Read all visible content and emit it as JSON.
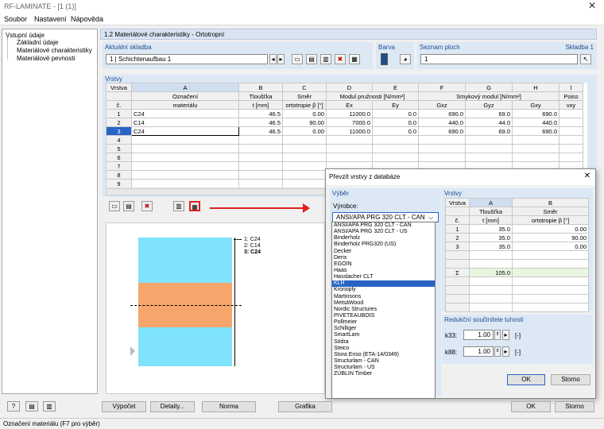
{
  "window": {
    "title": "RF-LAMINATE - [1 (1)]",
    "close": "✕"
  },
  "menu": [
    "Soubor",
    "Nastavení",
    "Nápověda"
  ],
  "tree": {
    "root": "Vstupní údaje",
    "items": [
      "Základní údaje",
      "Materiálové charakteristiky",
      "Materiálové pevnosti"
    ]
  },
  "header": "1.2 Materiálové charakteristiky - Ortotropní",
  "current": {
    "label": "Aktuální skladba",
    "value": "1 | Schichtenaufbau 1"
  },
  "color": {
    "label": "Barva",
    "swatch": "#1f4e8c"
  },
  "areas": {
    "label": "Seznam ploch",
    "value": "1",
    "right": "Skladba 1"
  },
  "layers": {
    "label": "Vrstvy",
    "letters": [
      "A",
      "B",
      "C",
      "D",
      "E",
      "F",
      "G",
      "H",
      "I"
    ],
    "h1": [
      "Vrstva",
      "Označení",
      "Tloušťka",
      "Směr",
      "Modul pružnosti [N/mm²]",
      "",
      "Smykový modul [N/mm²]",
      "",
      "",
      "Poiss"
    ],
    "h2": [
      "č.",
      "materiálu",
      "t [mm]",
      "ortotropie β [°]",
      "Ex",
      "Ey",
      "Gxz",
      "Gyz",
      "Gxy",
      "νxy"
    ],
    "rows": [
      [
        "1",
        "C24",
        "46.5",
        "0.00",
        "11000.0",
        "0.0",
        "690.0",
        "69.0",
        "690.0",
        ""
      ],
      [
        "2",
        "C14",
        "46.5",
        "90.00",
        "7000.0",
        "0.0",
        "440.0",
        "44.0",
        "440.0",
        ""
      ],
      [
        "3",
        "C24",
        "46.5",
        "0.00",
        "11000.0",
        "0.0",
        "690.0",
        "69.0",
        "690.0",
        ""
      ],
      [
        "4",
        "",
        "",
        "",
        "",
        "",
        "",
        "",
        "",
        ""
      ],
      [
        "5",
        "",
        "",
        "",
        "",
        "",
        "",
        "",
        "",
        ""
      ],
      [
        "6",
        "",
        "",
        "",
        "",
        "",
        "",
        "",
        "",
        ""
      ],
      [
        "7",
        "",
        "",
        "",
        "",
        "",
        "",
        "",
        "",
        ""
      ],
      [
        "8",
        "",
        "",
        "",
        "",
        "",
        "",
        "",
        "",
        ""
      ],
      [
        "9",
        "",
        "",
        "",
        "",
        "",
        "",
        "",
        "",
        ""
      ]
    ]
  },
  "legend": [
    "1: C24",
    "2: C14",
    "3: C24"
  ],
  "dialog": {
    "title": "Převzít vrstvy z databáze",
    "close": "✕",
    "select_label": "Výběr",
    "maker_label": "Výrobce:",
    "maker_value": "ANSI/APA PRG 320 CLT - CAN",
    "makers": [
      "ANSI/APA PRG 320 CLT - CAN",
      "ANSI/APA PRG 320 CLT - US",
      "Binderholz",
      "Binderholz PRG320 (US)",
      "Decker",
      "Derix",
      "EGOIN",
      "Haas",
      "Hasslacher CLT",
      "KLH",
      "Kronoply",
      "Martinsons",
      "MetsäWood",
      "Nordic Structures",
      "PIVETEAUBOIS",
      "Pollmeier",
      "Schilliger",
      "SmartLam",
      "Södra",
      "Steico",
      "Stora Enso (ETA-14/0349)",
      "Structurlam - CAN",
      "Structurlam - US",
      "ZÜBLIN Timber"
    ],
    "highlight": "KLH",
    "layers_label": "Vrstvy",
    "letters": [
      "A",
      "B"
    ],
    "h1": [
      "Vrstva",
      "Tloušťka",
      "Směr"
    ],
    "h2": [
      "č.",
      "t [mm]",
      "ortotropie β [°]"
    ],
    "rows": [
      [
        "1",
        "35.0",
        "0.00"
      ],
      [
        "2",
        "35.0",
        "90.00"
      ],
      [
        "3",
        "35.0",
        "0.00"
      ]
    ],
    "sum_label": "Σ",
    "sum": "105.0",
    "red_label": "Redukční součinitele tuhosti",
    "k33_label": "k33:",
    "k33": "1.00",
    "k88_label": "k88:",
    "k88": "1.00",
    "unit": "[-]",
    "ok": "OK",
    "cancel": "Storno"
  },
  "bottom": {
    "calc": "Výpočet",
    "details": "Detaily...",
    "norm": "Norma",
    "graphics": "Grafika",
    "ok": "OK",
    "cancel": "Storno"
  },
  "status": "Označení materiálu (F7 pro výběr)"
}
